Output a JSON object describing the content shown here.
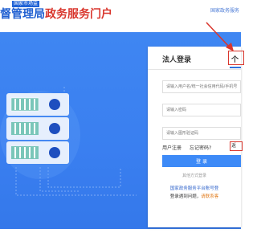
{
  "header": {
    "brand_small": "国家市场监",
    "title_part1": "督管理局",
    "title_part2": "政务服务门户",
    "top_link": "国家政务服务"
  },
  "login": {
    "tab_legal": "法人登录",
    "tab_personal": "个",
    "placeholders": {
      "username": "请输入用户名/统一社会信用代码/手机号",
      "password": "请输入密码",
      "captcha": "请输入图形验证码"
    },
    "register_link": "用户注册",
    "forgot_link": "忘记密码?",
    "back_link": "返",
    "login_button": "登 录",
    "other_login": "其他方式登录",
    "note_line1": "国家政务服务平台账号登",
    "note_line2_prefix": "登录遇到问题，",
    "note_line2_warn": "请联系客"
  },
  "colors": {
    "brand_blue": "#1f5fd1",
    "brand_red": "#d9362d",
    "hero_blue": "#3a7ff0",
    "button_blue": "#3d8af7"
  }
}
